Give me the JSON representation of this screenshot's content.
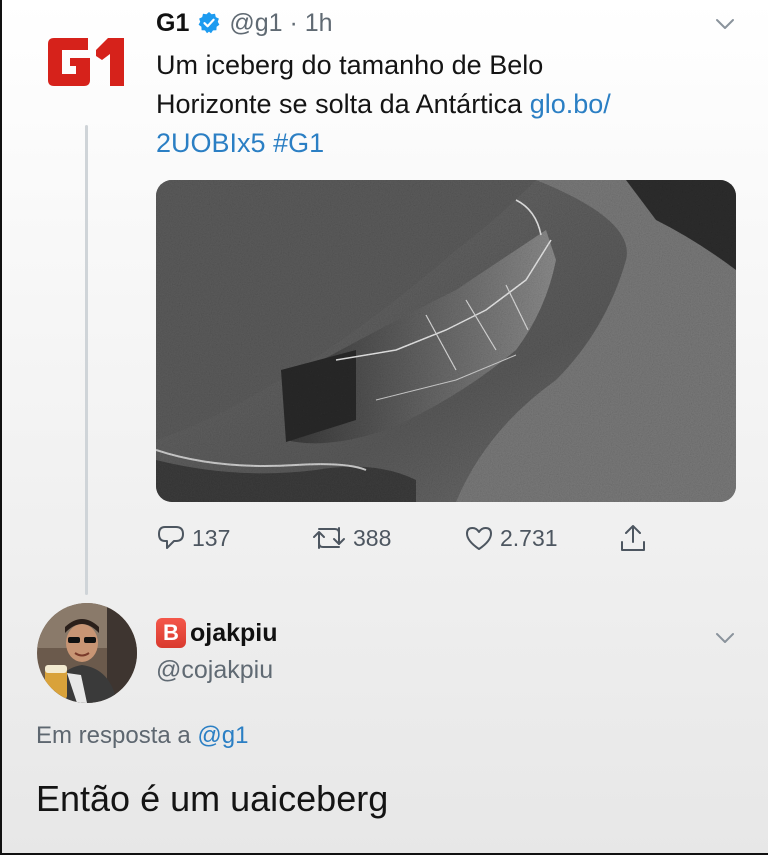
{
  "tweet": {
    "author_name": "G1",
    "handle_time": "@g1 · 1h",
    "text_line1": "Um iceberg do tamanho de Belo",
    "text_line2": "Horizonte se solta da Antártica",
    "link_part1": "glo.bo/",
    "link_part2": "2UOBIx5",
    "hashtag": "#G1",
    "logo_text": "G1",
    "logo_color": "#d6221b",
    "verified_color": "#1d9bf0",
    "media_icon": "satellite-iceberg-image",
    "actions": {
      "replies": "137",
      "retweets": "388",
      "likes": "2.731"
    }
  },
  "reply": {
    "badge_letter": "B",
    "author_name": "ojakpiu",
    "handle": "@cojakpiu",
    "in_reply_prefix": "Em resposta a",
    "in_reply_mention": "@g1",
    "text": "Então é um uaiceberg"
  },
  "colors": {
    "link": "#2b7fc4",
    "secondary_text": "#606a73",
    "thread_line": "#cfd4d8"
  }
}
